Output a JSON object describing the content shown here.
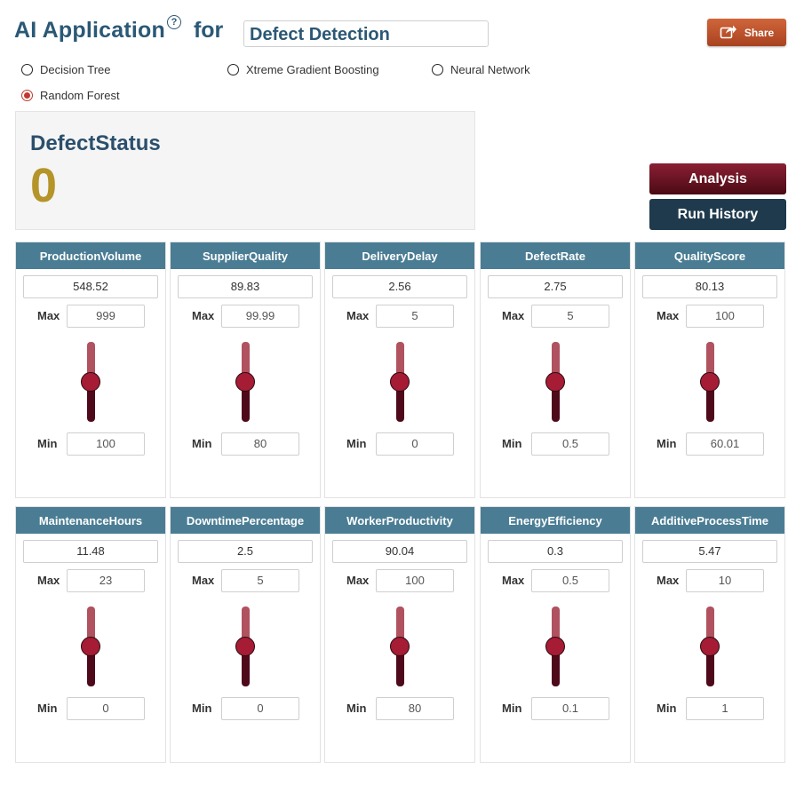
{
  "header": {
    "app_title": "AI Application",
    "help_symbol": "?",
    "for_label": "for",
    "use_case": "Defect Detection",
    "share_label": "Share"
  },
  "models": [
    {
      "label": "Decision Tree",
      "selected": false
    },
    {
      "label": "Xtreme Gradient Boosting",
      "selected": false
    },
    {
      "label": "Neural Network",
      "selected": false
    },
    {
      "label": "Random Forest",
      "selected": true
    }
  ],
  "status": {
    "label": "DefectStatus",
    "value": "0"
  },
  "buttons": {
    "analysis": "Analysis",
    "run_history": "Run History"
  },
  "labels": {
    "max": "Max",
    "min": "Min"
  },
  "features": [
    {
      "name": "ProductionVolume",
      "value": "548.52",
      "max": "999",
      "min": "100",
      "level": 0.5
    },
    {
      "name": "SupplierQuality",
      "value": "89.83",
      "max": "99.99",
      "min": "80",
      "level": 0.5
    },
    {
      "name": "DeliveryDelay",
      "value": "2.56",
      "max": "5",
      "min": "0",
      "level": 0.5
    },
    {
      "name": "DefectRate",
      "value": "2.75",
      "max": "5",
      "min": "0.5",
      "level": 0.5
    },
    {
      "name": "QualityScore",
      "value": "80.13",
      "max": "100",
      "min": "60.01",
      "level": 0.5
    },
    {
      "name": "MaintenanceHours",
      "value": "11.48",
      "max": "23",
      "min": "0",
      "level": 0.5
    },
    {
      "name": "DowntimePercentage",
      "value": "2.5",
      "max": "5",
      "min": "0",
      "level": 0.5
    },
    {
      "name": "WorkerProductivity",
      "value": "90.04",
      "max": "100",
      "min": "80",
      "level": 0.5
    },
    {
      "name": "EnergyEfficiency",
      "value": "0.3",
      "max": "0.5",
      "min": "0.1",
      "level": 0.5
    },
    {
      "name": "AdditiveProcessTime",
      "value": "5.47",
      "max": "10",
      "min": "1",
      "level": 0.5
    }
  ],
  "colors": {
    "title": "#2b5876",
    "card_header": "#4a7d94",
    "status_value": "#b5942a",
    "slider_thumb": "#a51c34",
    "analysis_button": "#6b1526",
    "history_button": "#1f3a4d",
    "share_button": "#c0532c"
  }
}
